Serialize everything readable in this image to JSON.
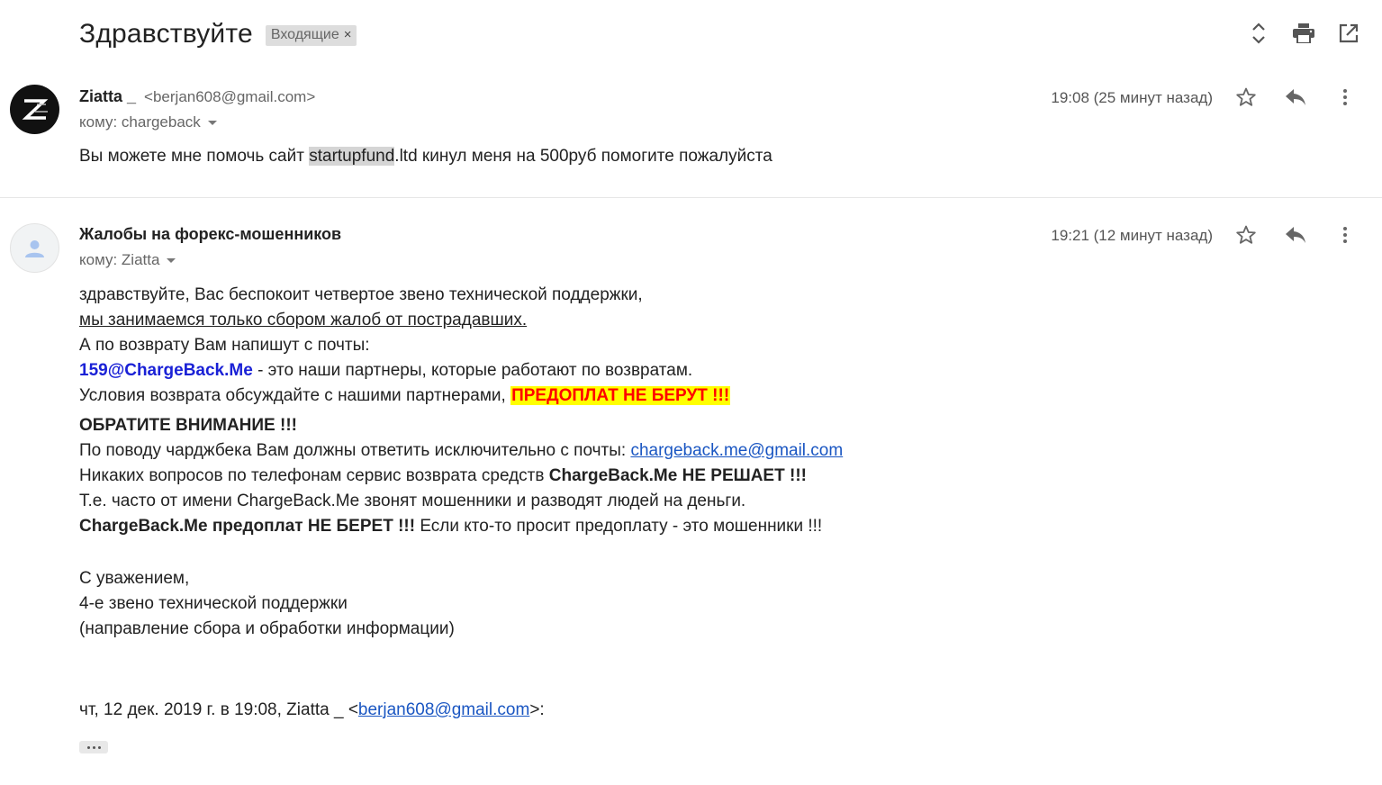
{
  "thread": {
    "subject": "Здравствуйте",
    "label": "Входящие",
    "label_remove": "×"
  },
  "top_actions": {
    "icons": [
      "expand-collapse-icon",
      "print-icon",
      "open-in-new-window-icon"
    ]
  },
  "messages": [
    {
      "sender_name": "Ziatta _",
      "sender_email": "<berjan608@gmail.com>",
      "recipient": "кому: chargeback",
      "time": "19:08 (25 минут назад)",
      "snippet_before": "Вы можете мне помочь сайт ",
      "snippet_highlight": "startupfund",
      "snippet_after": ".ltd кинул меня на 500руб помогите пожалуйста"
    },
    {
      "sender_name": "Жалобы на форекс-мошенников",
      "recipient": "кому: Ziatta",
      "time": "19:21 (12 минут назад)",
      "body": {
        "l1": "здравствуйте, Вас беспокоит четвертое звено технической поддержки,",
        "l2": "мы занимаемся только сбором жалоб от пострадавших.",
        "l3": "А по возврату Вам напишут с почты:",
        "l4_email": "159@ChargeBack.Me",
        "l4_rest": " - это наши партнеры, которые работают по возвратам.",
        "l5": "Условия возврата обсуждайте с нашими партнерами, ",
        "l5_warn": "ПРЕДОПЛАТ НЕ БЕРУТ !!!",
        "l6": "ОБРАТИТЕ ВНИМАНИЕ !!!",
        "l7": "По поводу чарджбека Вам должны ответить исключительно с почты: ",
        "l7_link": "chargeback.me@gmail.com",
        "l8": "Никаких вопросов по телефонам сервис возврата средств ",
        "l8_bold": "ChargeBack.Me НЕ РЕШАЕТ !!!",
        "l9": "Т.е. часто от имени ChargeBack.Me звонят мошенники и разводят людей на деньги.",
        "l10_bold": "ChargeBack.Me предоплат НЕ БЕРЕТ !!!",
        "l10_rest": " Если кто-то просит предоплату - это мошенники !!!",
        "sig1": "С уважением,",
        "sig2": "4-е звено технической поддержки",
        "sig3": "(направление сбора и обработки информации)"
      },
      "quote_prefix": "чт, 12 дек. 2019 г. в 19:08, Ziatta _ <",
      "quote_link": "berjan608@gmail.com",
      "quote_suffix": ">:"
    }
  ],
  "message_actions": [
    "star-icon",
    "reply-icon",
    "more-vert-icon"
  ]
}
